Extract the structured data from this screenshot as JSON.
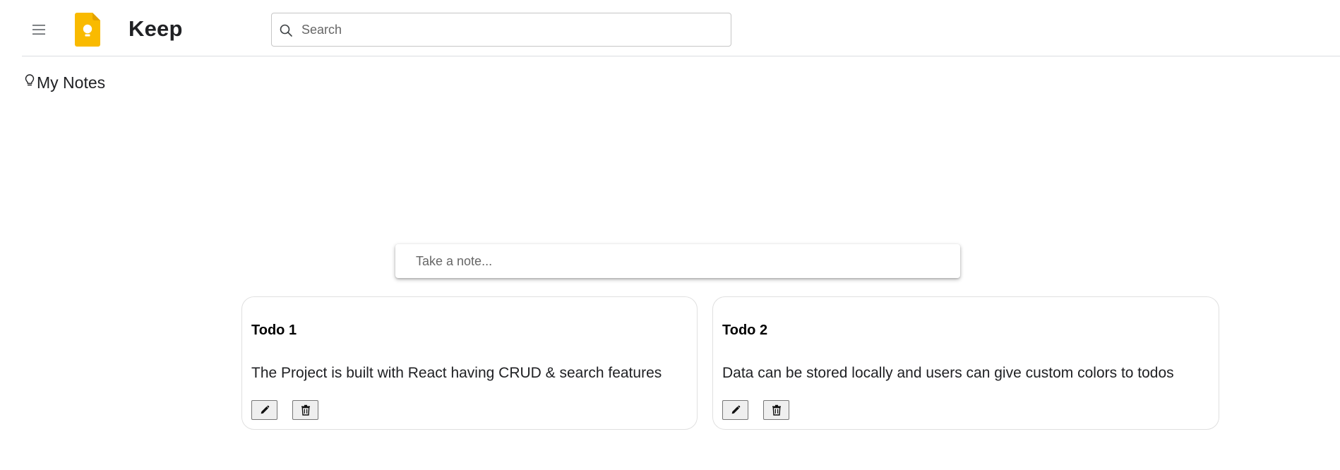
{
  "header": {
    "menu_icon": "hamburger-menu-icon",
    "logo_icon": "keep-bulb-logo-icon",
    "logo_color": "#F9BA00",
    "title": "Keep",
    "search": {
      "placeholder": "Search",
      "value": "",
      "icon": "search-icon"
    }
  },
  "section": {
    "icon": "lightbulb-icon",
    "title": "My Notes"
  },
  "composer": {
    "placeholder": "Take a note...",
    "value": ""
  },
  "notes": [
    {
      "title": "Todo 1",
      "body": "The Project is built with React having CRUD & search features",
      "actions": [
        "edit-icon",
        "delete-icon"
      ]
    },
    {
      "title": "Todo 2",
      "body": "Data can be stored locally and users can give custom colors to todos",
      "actions": [
        "edit-icon",
        "delete-icon"
      ]
    }
  ]
}
